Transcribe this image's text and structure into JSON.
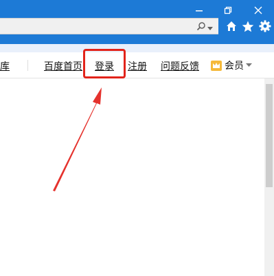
{
  "nav": {
    "partial_left": "库",
    "links": [
      "百度首页",
      "登录",
      "注册",
      "问题反馈"
    ],
    "member_label": "会员"
  },
  "icons": {
    "minimize": "minimize-icon",
    "restore": "restore-icon",
    "close": "close-icon",
    "search": "search-icon",
    "dropdown": "chevron-down-icon",
    "home": "home-icon",
    "favorites": "star-icon",
    "tools": "gear-icon",
    "member": "crown-icon"
  },
  "colors": {
    "titlebar": "#1d7ad6",
    "highlight": "#e2231a",
    "arrow": "#e5322d"
  }
}
